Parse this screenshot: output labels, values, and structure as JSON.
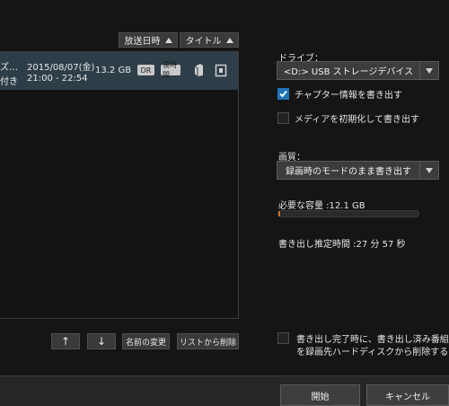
{
  "sort": {
    "date_label": "放送日時",
    "title_label": "タイトル"
  },
  "recordings": [
    {
      "title": "ズ…",
      "subtitle": "付き",
      "date": "2015/08/07(金)",
      "time": "21:00 - 22:54",
      "size": "13.2 GB",
      "badge_dr": "DR",
      "badge_long": "長時間",
      "selected": true
    }
  ],
  "list_buttons": {
    "up": "↑",
    "down": "↓",
    "rename": "名前の変更",
    "remove": "リストから削除"
  },
  "drive": {
    "label": "ドライブ：",
    "selected": "<D:> USB ストレージデバイス"
  },
  "chapter": {
    "label": "チャプター情報を書き出す",
    "checked": true
  },
  "init_media": {
    "label": "メディアを初期化して書き出す",
    "checked": false
  },
  "quality": {
    "label": "画質：",
    "selected": "録画時のモードのまま書き出す"
  },
  "capacity": {
    "text": "必要な容量 :12.1 GB",
    "progress_fraction": 0.01,
    "bar_color": "#d56f1e"
  },
  "estimate": {
    "text": "書き出し推定時間 :27 分 57 秒"
  },
  "delete_after": {
    "line1": "書き出し完了時に、書き出し済み番組",
    "line2": "を録画先ハードディスクから削除する",
    "checked": false
  },
  "footer": {
    "start": "開始",
    "cancel": "キャンセル"
  },
  "colors": {
    "accent": "#1f73b7",
    "selected_row": "#2e3e48"
  }
}
